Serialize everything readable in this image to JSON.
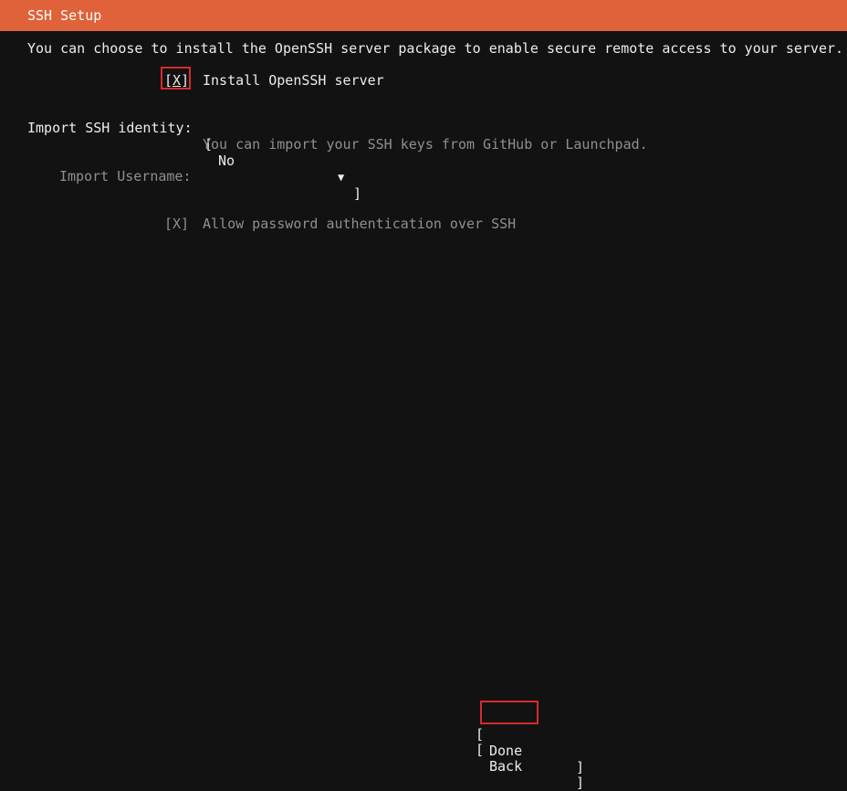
{
  "header": {
    "title": "SSH Setup"
  },
  "intro": {
    "text": "You can choose to install the OpenSSH server package to enable secure remote access to your server."
  },
  "install_openssh": {
    "checkbox_open": "[",
    "checkbox_mark": "X",
    "checkbox_close": "]",
    "label": "Install OpenSSH server",
    "checked": true
  },
  "import_identity": {
    "label": "Import SSH identity:",
    "dropdown_open": "[",
    "value": "No",
    "arrow": "▼",
    "dropdown_close": "]",
    "help": "You can import your SSH keys from GitHub or Launchpad."
  },
  "import_username": {
    "label": "Import Username:"
  },
  "allow_password": {
    "checkbox": "[X]",
    "label": "Allow password authentication over SSH",
    "checked": true
  },
  "buttons": {
    "done": {
      "open": "[",
      "label": "Done",
      "close": "]"
    },
    "back": {
      "open": "[",
      "label": "Back",
      "close": "]"
    }
  },
  "colors": {
    "header_bg": "#e0623a",
    "background": "#121212",
    "highlight_box": "#d82a2a"
  }
}
